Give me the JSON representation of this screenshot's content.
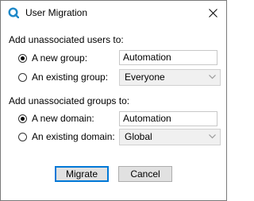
{
  "window": {
    "title": "User Migration",
    "close_glyph": "✕"
  },
  "users_section": {
    "label": "Add unassociated users to:",
    "new_option": {
      "label": "A new group:",
      "checked": true,
      "value": "Automation"
    },
    "existing_option": {
      "label": "An existing group:",
      "checked": false,
      "selected": "Everyone"
    }
  },
  "groups_section": {
    "label": "Add unassociated groups to:",
    "new_option": {
      "label": "A new domain:",
      "checked": true,
      "value": "Automation"
    },
    "existing_option": {
      "label": "An existing domain:",
      "checked": false,
      "selected": "Global"
    }
  },
  "buttons": {
    "migrate": "Migrate",
    "cancel": "Cancel"
  },
  "colors": {
    "icon_accent": "#1e88c8",
    "default_button_border": "#0078d7"
  }
}
